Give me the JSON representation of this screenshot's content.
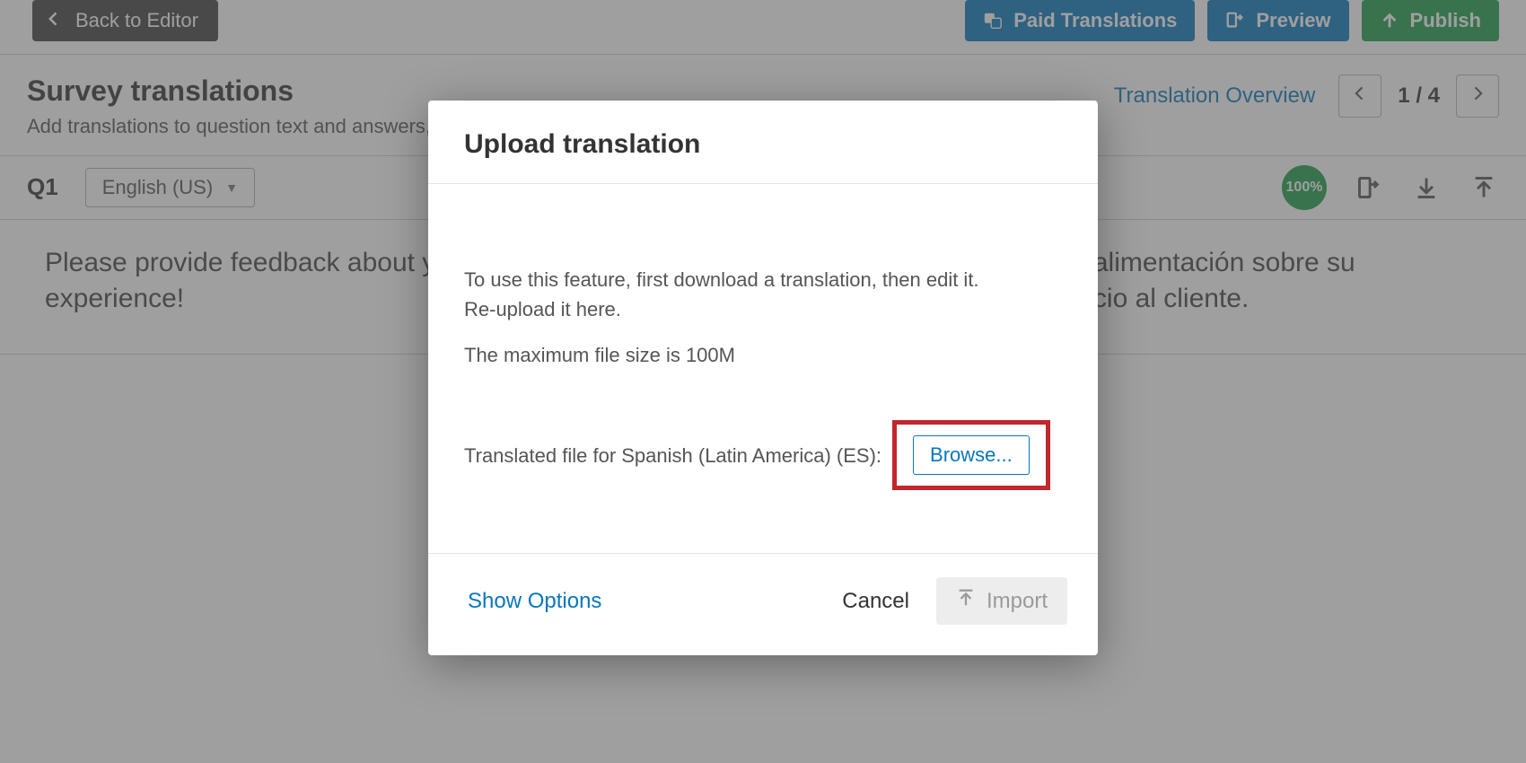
{
  "topbar": {
    "back": "Back to Editor",
    "paid": "Paid Translations",
    "preview": "Preview",
    "publish": "Publish"
  },
  "heading": {
    "title": "Survey translations",
    "subtitle": "Add translations to question text and answers, display names, survey title, and description.",
    "overview": "Translation Overview",
    "pager": "1 / 4"
  },
  "qrow": {
    "id": "Q1",
    "language": "English (US)",
    "progress": "100%"
  },
  "content": {
    "left": "Please provide feedback about your customer service experience!",
    "right": "Favor de proveer retroalimentación sobre su experiencia en el servicio al cliente."
  },
  "dialog": {
    "title": "Upload translation",
    "para1_line1": "To use this feature, first download a translation, then edit it.",
    "para1_line2": "Re-upload it here.",
    "para2": "The maximum file size is 100M",
    "file_label": "Translated file for Spanish (Latin America) (ES):",
    "browse": "Browse...",
    "show_options": "Show Options",
    "cancel": "Cancel",
    "import": "Import"
  }
}
